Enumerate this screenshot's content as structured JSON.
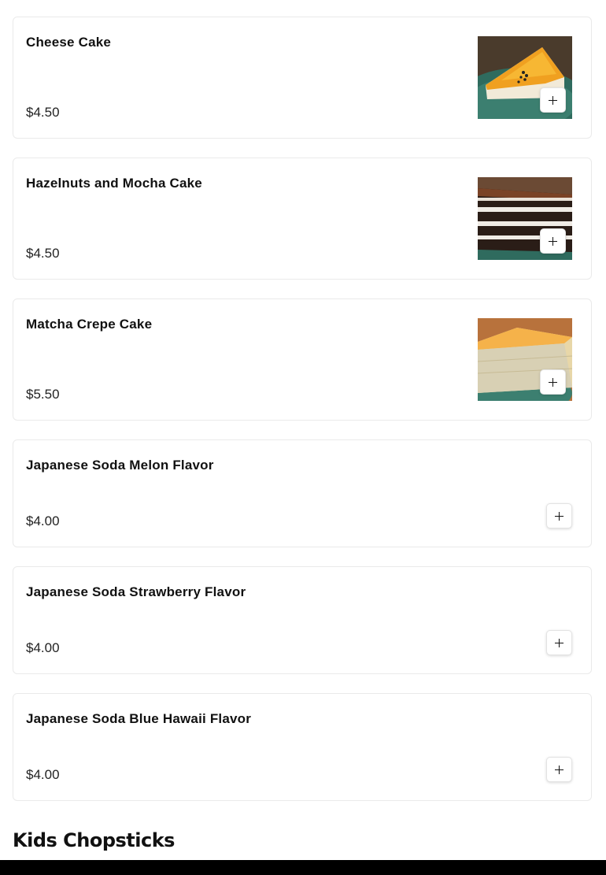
{
  "items": [
    {
      "name": "Cheese Cake",
      "price": "$4.50"
    },
    {
      "name": "Hazelnuts and Mocha Cake",
      "price": "$4.50"
    },
    {
      "name": "Matcha Crepe Cake",
      "price": "$5.50"
    },
    {
      "name": "Japanese Soda Melon Flavor",
      "price": "$4.00"
    },
    {
      "name": "Japanese Soda Strawberry Flavor",
      "price": "$4.00"
    },
    {
      "name": "Japanese Soda Blue Hawaii Flavor",
      "price": "$4.00"
    }
  ],
  "section": {
    "title": "Kids Chopsticks"
  },
  "icons": {
    "add": "plus-icon"
  },
  "colors": {
    "card_border": "#eaeaea",
    "text": "#111111",
    "bottom_bar": "#000000"
  }
}
